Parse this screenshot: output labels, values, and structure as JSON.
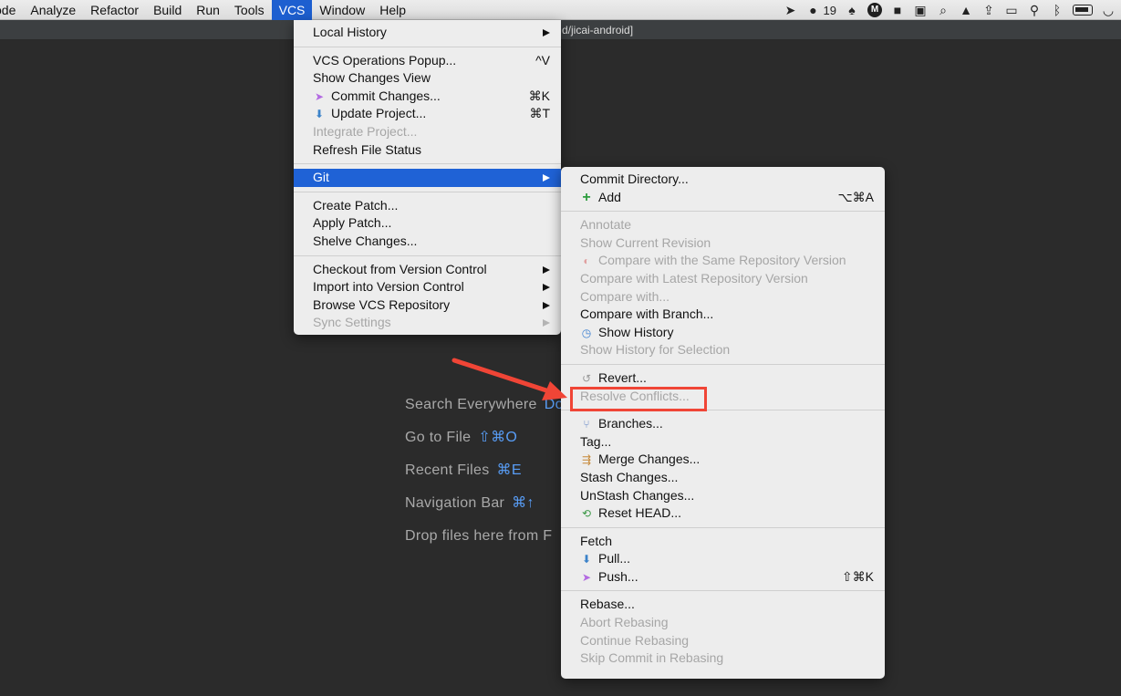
{
  "menubar": {
    "items": [
      "ode",
      "Analyze",
      "Refactor",
      "Build",
      "Run",
      "Tools",
      "VCS",
      "Window",
      "Help"
    ],
    "active_index": 6,
    "tray_badge": "19"
  },
  "ide": {
    "path": "d/jicai-android]",
    "hints": [
      {
        "label": "Search Everywhere",
        "shortcut": "Do"
      },
      {
        "label": "Go to File",
        "shortcut": "⇧⌘O"
      },
      {
        "label": "Recent Files",
        "shortcut": "⌘E"
      },
      {
        "label": "Navigation Bar",
        "shortcut": "⌘↑"
      },
      {
        "label": "Drop files here from F",
        "shortcut": ""
      }
    ]
  },
  "vcs_menu": {
    "local_history": "Local History",
    "vcs_operations_popup": "VCS Operations Popup...",
    "vcs_operations_popup_sc": "^V",
    "show_changes_view": "Show Changes View",
    "commit_changes": "Commit Changes...",
    "commit_changes_sc": "⌘K",
    "update_project": "Update Project...",
    "update_project_sc": "⌘T",
    "integrate_project": "Integrate Project...",
    "refresh_file_status": "Refresh File Status",
    "git": "Git",
    "create_patch": "Create Patch...",
    "apply_patch": "Apply Patch...",
    "shelve_changes": "Shelve Changes...",
    "checkout": "Checkout from Version Control",
    "import": "Import into Version Control",
    "browse": "Browse VCS Repository",
    "sync_settings": "Sync Settings"
  },
  "git_menu": {
    "commit_directory": "Commit Directory...",
    "add": "Add",
    "add_sc": "⌥⌘A",
    "annotate": "Annotate",
    "show_current_revision": "Show Current Revision",
    "compare_same_repo": "Compare with the Same Repository Version",
    "compare_latest": "Compare with Latest Repository Version",
    "compare_with": "Compare with...",
    "compare_branch": "Compare with Branch...",
    "show_history": "Show History",
    "show_history_selection": "Show History for Selection",
    "revert": "Revert...",
    "resolve_conflicts": "Resolve Conflicts...",
    "branches": "Branches...",
    "tag": "Tag...",
    "merge_changes": "Merge Changes...",
    "stash_changes": "Stash Changes...",
    "unstash_changes": "UnStash Changes...",
    "reset_head": "Reset HEAD...",
    "fetch": "Fetch",
    "pull": "Pull...",
    "push": "Push...",
    "push_sc": "⇧⌘K",
    "rebase": "Rebase...",
    "abort_rebasing": "Abort Rebasing",
    "continue_rebasing": "Continue Rebasing",
    "skip_commit": "Skip Commit in Rebasing"
  },
  "annotation": {
    "color": "#f04536"
  }
}
